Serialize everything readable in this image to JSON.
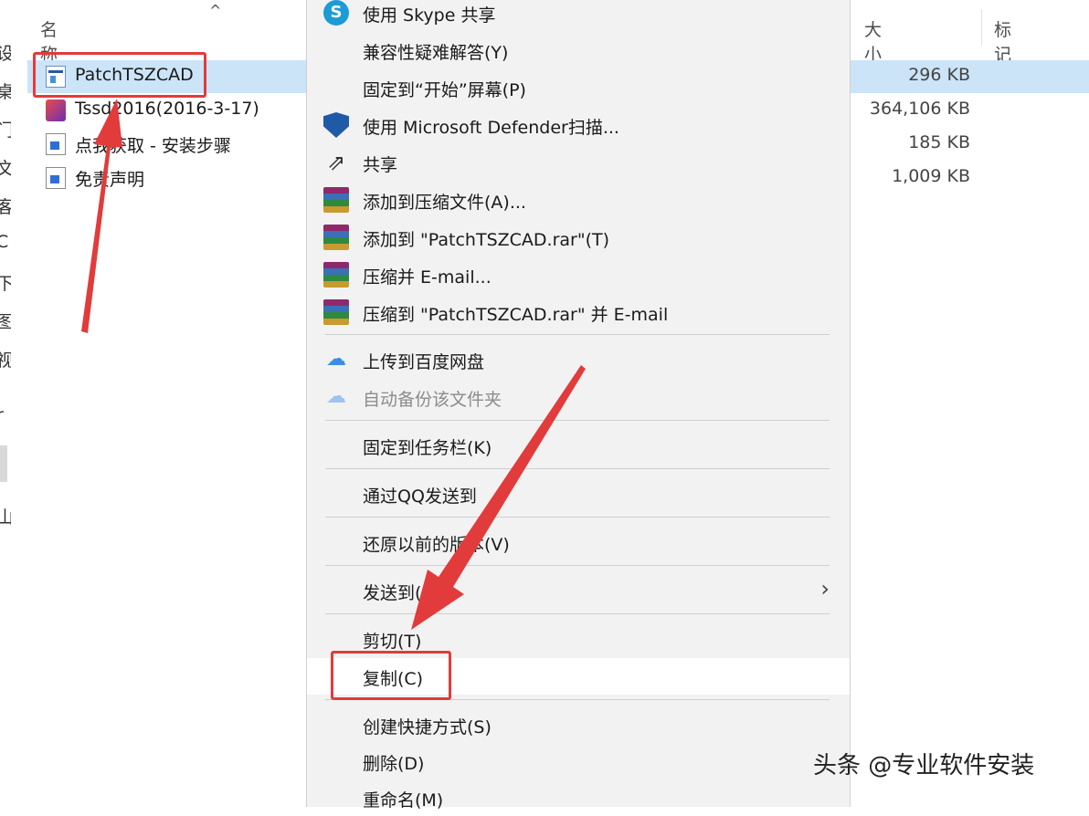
{
  "nav_glyphs": [
    "设",
    "桌",
    "门",
    "文",
    "客",
    "C",
    "下",
    "图",
    "视",
    "r",
    "山"
  ],
  "columns": {
    "name": "名称",
    "size": "大小",
    "tag": "标记",
    "sort_icon": "chevron-up-icon"
  },
  "files": [
    {
      "name": "PatchTSZCAD",
      "size": "296 KB",
      "icon": "exe-icon",
      "selected": true
    },
    {
      "name": "Tssd2016(2016-3-17)",
      "size": "364,106 KB",
      "icon": "app-icon"
    },
    {
      "name": "点我获取 - 安装步骤",
      "size": "185 KB",
      "icon": "doc-icon"
    },
    {
      "name": "免责声明",
      "size": "1,009 KB",
      "icon": "doc-icon"
    }
  ],
  "menu": {
    "items": [
      {
        "label": "使用 Skype 共享",
        "icon": "skype-icon"
      },
      {
        "label": "兼容性疑难解答(Y)"
      },
      {
        "label": "固定到“开始”屏幕(P)"
      },
      {
        "label": "使用 Microsoft Defender扫描...",
        "icon": "defender-icon"
      },
      {
        "label": "共享",
        "icon": "share-icon"
      },
      {
        "label": "添加到压缩文件(A)...",
        "icon": "winrar-icon"
      },
      {
        "label": "添加到 \"PatchTSZCAD.rar\"(T)",
        "icon": "winrar-icon"
      },
      {
        "label": "压缩并 E-mail...",
        "icon": "winrar-icon"
      },
      {
        "label": "压缩到 \"PatchTSZCAD.rar\" 并 E-mail",
        "icon": "winrar-icon"
      },
      {
        "label": "上传到百度网盘",
        "icon": "baidu-netdisk-icon"
      },
      {
        "label": "自动备份该文件夹",
        "icon": "baidu-netdisk-icon",
        "disabled": true
      },
      {
        "label": "固定到任务栏(K)"
      },
      {
        "label": "通过QQ发送到"
      },
      {
        "label": "还原以前的版本(V)"
      },
      {
        "label": "发送到(N)",
        "submenu": true
      },
      {
        "label": "剪切(T)"
      },
      {
        "label": "复制(C)",
        "highlighted": true
      },
      {
        "label": "创建快捷方式(S)"
      },
      {
        "label": "删除(D)"
      },
      {
        "label": "重命名(M)"
      }
    ]
  },
  "annotation_color": "#e23b3b",
  "watermark": "头条 @专业软件安装"
}
